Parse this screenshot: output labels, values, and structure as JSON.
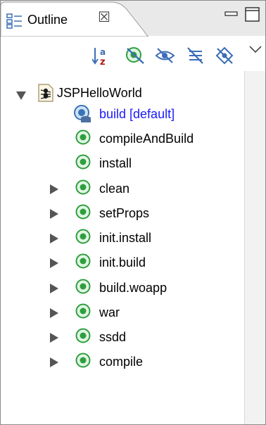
{
  "view": {
    "title": "Outline",
    "close_symbol": "☒",
    "icons": {
      "tab": "outline-view-icon",
      "minimize": "minimize-icon",
      "maximize": "maximize-icon"
    }
  },
  "toolbar": {
    "items": [
      {
        "name": "sort",
        "icon": "sort-alphabetical-icon"
      },
      {
        "name": "hide-fields",
        "icon": "hide-fields-icon"
      },
      {
        "name": "hide-static",
        "icon": "hide-static-members-icon"
      },
      {
        "name": "hide-nonpublic",
        "icon": "hide-non-public-icon"
      },
      {
        "name": "hide-local",
        "icon": "hide-local-types-icon"
      },
      {
        "name": "view-menu",
        "icon": "view-menu-chevron-icon"
      }
    ]
  },
  "tree": {
    "root": {
      "label": "JSPHelloWorld",
      "icon": "ant-buildfile-icon",
      "expanded": true
    },
    "targets": [
      {
        "label": "build [default]",
        "icon": "default-target-icon",
        "default": true,
        "expandable": false
      },
      {
        "label": "compileAndBuild",
        "icon": "target-icon",
        "default": false,
        "expandable": false
      },
      {
        "label": "install",
        "icon": "target-icon",
        "default": false,
        "expandable": false
      },
      {
        "label": "clean",
        "icon": "target-icon",
        "default": false,
        "expandable": true
      },
      {
        "label": "setProps",
        "icon": "target-icon",
        "default": false,
        "expandable": true
      },
      {
        "label": "init.install",
        "icon": "target-icon",
        "default": false,
        "expandable": true
      },
      {
        "label": "init.build",
        "icon": "target-icon",
        "default": false,
        "expandable": true
      },
      {
        "label": "build.woapp",
        "icon": "target-icon",
        "default": false,
        "expandable": true
      },
      {
        "label": "war",
        "icon": "target-icon",
        "default": false,
        "expandable": true
      },
      {
        "label": "ssdd",
        "icon": "target-icon",
        "default": false,
        "expandable": true
      },
      {
        "label": "compile",
        "icon": "target-icon",
        "default": false,
        "expandable": true
      }
    ]
  },
  "colors": {
    "default_target_text": "#1a1aff",
    "target_green": "#2f9e3f",
    "titlebar_bg": "#e9e9e9"
  }
}
